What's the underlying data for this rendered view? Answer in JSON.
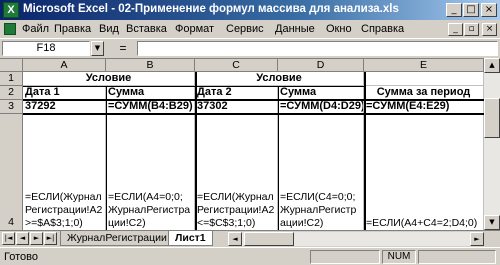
{
  "window": {
    "title": "Microsoft Excel - 02-Применение формул массива для анализа.xls",
    "app_icon_letter": "X",
    "buttons": {
      "minimize": "_",
      "maximize": "□",
      "close": "×"
    }
  },
  "menu": {
    "items": [
      "Файл",
      "Правка",
      "Вид",
      "Вставка",
      "Формат",
      "Сервис",
      "Данные",
      "Окно",
      "Справка"
    ],
    "doc_buttons": {
      "minimize": "_",
      "restore": "▫",
      "close": "×"
    }
  },
  "formula_bar": {
    "name_box": "F18",
    "name_box_arrow": "▼",
    "equals": "=",
    "value": ""
  },
  "grid": {
    "columns": [
      "A",
      "B",
      "C",
      "D",
      "E"
    ],
    "rows": [
      "1",
      "2",
      "3",
      "4"
    ],
    "cells": {
      "A1": "Условие",
      "C1": "Условие",
      "A2": "Дата 1",
      "B2": "Сумма",
      "C2": "Дата 2",
      "D2": "Сумма",
      "E2": "Сумма за период",
      "A3": "37292",
      "B3": "=СУММ(B4:B29)",
      "C3": "37302",
      "D3": "=СУММ(D4:D29)",
      "E3": "=СУММ(E4:E29)",
      "A4": "=ЕСЛИ(ЖурналРегистрации!A2>=$A$3;1;0)",
      "B4": "=ЕСЛИ(A4=0;0;ЖурналРегистрации!C2)",
      "C4": "=ЕСЛИ(ЖурналРегистрации!A2<=$C$3;1;0)",
      "D4": "=ЕСЛИ(C4=0;0;ЖурналРегистрации!C2)",
      "E4": "=ЕСЛИ(A4+C4=2;D4;0)"
    }
  },
  "sheet_tabs": {
    "nav": [
      "|◄",
      "◄",
      "►",
      "►|"
    ],
    "tabs": [
      {
        "label": "ЖурналРегистрации",
        "active": false
      },
      {
        "label": "Лист1",
        "active": true
      }
    ]
  },
  "status_bar": {
    "text": "Готово",
    "num": "NUM"
  }
}
